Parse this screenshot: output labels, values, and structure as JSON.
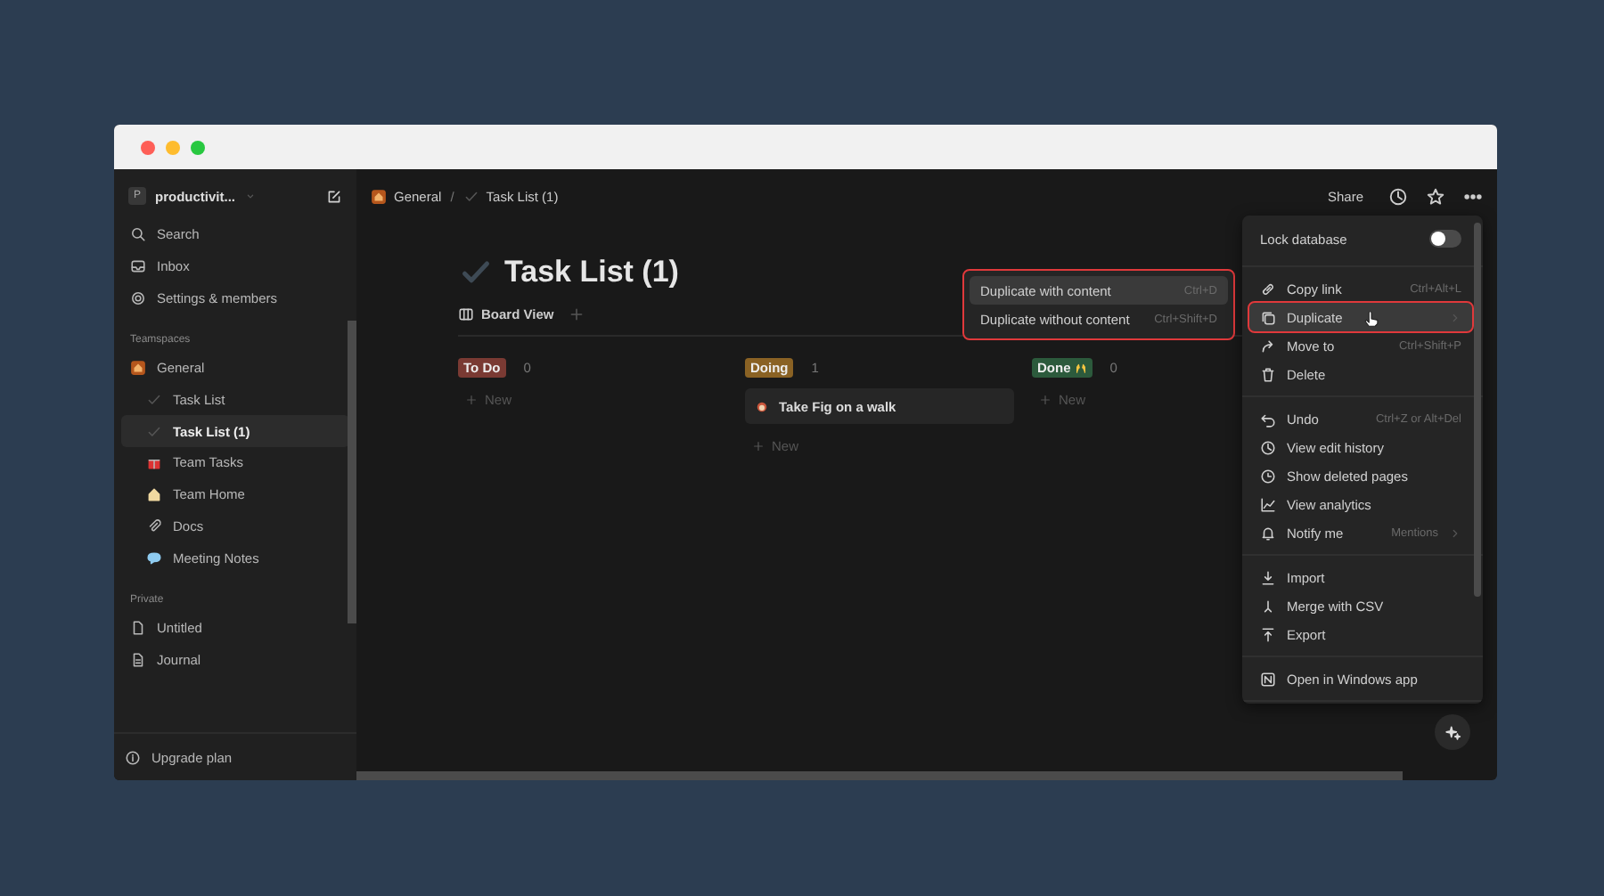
{
  "sidebar": {
    "workspace": {
      "initial": "P",
      "name": "productivit..."
    },
    "nav": [
      {
        "label": "Search"
      },
      {
        "label": "Inbox"
      },
      {
        "label": "Settings & members"
      }
    ],
    "sections": [
      {
        "title": "Teamspaces",
        "items": [
          {
            "label": "General",
            "selected": false,
            "children": [
              {
                "label": "Task List",
                "selected": false
              },
              {
                "label": "Task List (1)",
                "selected": true
              },
              {
                "label": "Team Tasks",
                "selected": false
              },
              {
                "label": "Team Home",
                "selected": false
              },
              {
                "label": "Docs",
                "selected": false
              },
              {
                "label": "Meeting Notes",
                "selected": false
              }
            ]
          }
        ]
      },
      {
        "title": "Private",
        "items": [
          {
            "label": "Untitled",
            "selected": false
          },
          {
            "label": "Journal",
            "selected": false
          }
        ]
      }
    ],
    "footer": "Upgrade plan"
  },
  "topbar": {
    "breadcrumb": [
      {
        "label": "General"
      },
      {
        "label": "Task List (1)"
      }
    ],
    "separator": "/",
    "share": "Share"
  },
  "page": {
    "title": "Task List (1)",
    "view": "Board View",
    "columns": [
      {
        "label": "To Do",
        "count": "0",
        "color": "#7a3a33",
        "new": "New"
      },
      {
        "label": "Doing",
        "count": "1",
        "color": "#8a6224",
        "cards": [
          "Take Fig on a walk"
        ],
        "new": "New"
      },
      {
        "label": "Done",
        "count": "0",
        "color": "#2c5a3c",
        "new": "New"
      }
    ]
  },
  "submenu": {
    "highlighted": true,
    "items": [
      {
        "label": "Duplicate with content",
        "shortcut": "Ctrl+D",
        "selected": true
      },
      {
        "label": "Duplicate without content",
        "shortcut": "Ctrl+Shift+D",
        "selected": false
      }
    ]
  },
  "menu": {
    "items": [
      {
        "kind": "toggle",
        "label": "Lock database",
        "on": false
      },
      {
        "kind": "divider"
      },
      {
        "kind": "item",
        "label": "Copy link",
        "shortcut": "Ctrl+Alt+L",
        "selected": false,
        "highlighted": false
      },
      {
        "kind": "item",
        "label": "Duplicate",
        "selected": true,
        "highlighted": true,
        "submenu": true
      },
      {
        "kind": "item",
        "label": "Move to",
        "shortcut": "Ctrl+Shift+P",
        "selected": false,
        "highlighted": false
      },
      {
        "kind": "item",
        "label": "Delete",
        "selected": false,
        "highlighted": false
      },
      {
        "kind": "divider"
      },
      {
        "kind": "item",
        "label": "Undo",
        "shortcut": "Ctrl+Z or Alt+Del",
        "selected": false,
        "highlighted": false
      },
      {
        "kind": "item",
        "label": "View edit history",
        "selected": false,
        "highlighted": false
      },
      {
        "kind": "item",
        "label": "Show deleted pages",
        "selected": false,
        "highlighted": false
      },
      {
        "kind": "item",
        "label": "View analytics",
        "selected": false,
        "highlighted": false
      },
      {
        "kind": "item",
        "label": "Notify me",
        "shortcut": "Mentions",
        "submenu": true,
        "selected": false,
        "highlighted": false
      },
      {
        "kind": "divider"
      },
      {
        "kind": "item",
        "label": "Import",
        "selected": false,
        "highlighted": false
      },
      {
        "kind": "item",
        "label": "Merge with CSV",
        "selected": false,
        "highlighted": false
      },
      {
        "kind": "item",
        "label": "Export",
        "selected": false,
        "highlighted": false
      },
      {
        "kind": "divider"
      },
      {
        "kind": "item",
        "label": "Open in Windows app",
        "selected": false,
        "highlighted": false
      },
      {
        "kind": "divider"
      }
    ]
  }
}
